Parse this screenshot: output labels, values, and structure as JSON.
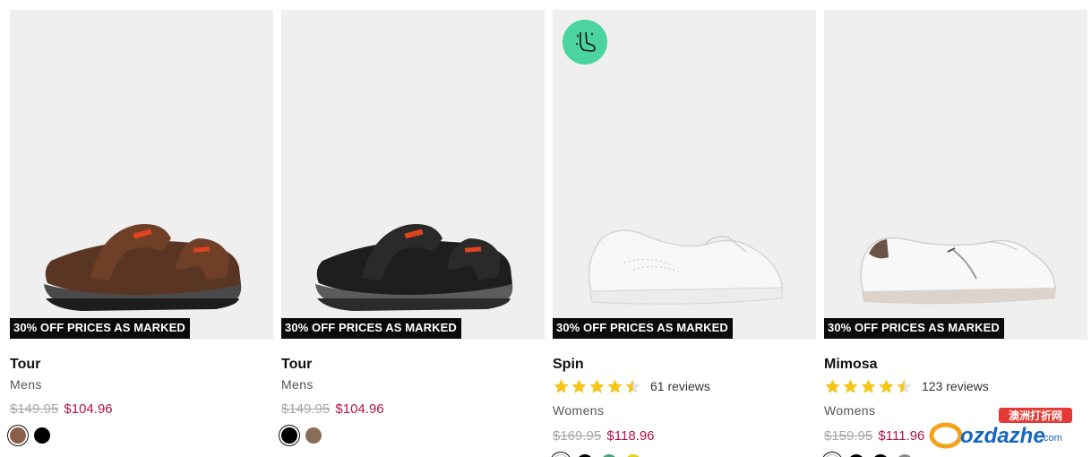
{
  "products": [
    {
      "name": "Tour",
      "category": "Mens",
      "old_price": "$149.95",
      "new_price": "$104.96",
      "promo": "30% OFF PRICES AS MARKED",
      "image_icon": "brown-leather-sandal-image",
      "colors": [
        "#8a5f45",
        "#000000"
      ],
      "selected_color": 0
    },
    {
      "name": "Tour",
      "category": "Mens",
      "old_price": "$149.95",
      "new_price": "$104.96",
      "promo": "30% OFF PRICES AS MARKED",
      "image_icon": "black-leather-sandal-image",
      "colors": [
        "#000000",
        "#8a6d56"
      ],
      "selected_color": 0
    },
    {
      "name": "Spin",
      "category": "Womens",
      "old_price": "$169.95",
      "new_price": "$118.96",
      "promo": "30% OFF PRICES AS MARKED",
      "rating": 4.5,
      "reviews": "61 reviews",
      "badge_icon": "foot-comfort-icon",
      "image_icon": "white-sneaker-image",
      "colors": [
        "#ffffff",
        "#000000",
        "#4aa37a",
        "#e5d020"
      ],
      "selected_color": 0
    },
    {
      "name": "Mimosa",
      "category": "Womens",
      "old_price": "$159.95",
      "new_price": "$111.96",
      "promo": "30% OFF PRICES AS MARKED",
      "rating": 4.5,
      "reviews": "123 reviews",
      "image_icon": "white-zip-sneaker-image",
      "colors": [
        "#ffffff",
        "#000000",
        "#000000",
        "#888888"
      ],
      "selected_color": 0
    }
  ],
  "watermark": {
    "top": "澳洲打折网",
    "main": "ozdazhe",
    "suffix": ".com"
  },
  "colors": {
    "sale_price": "#b5124a",
    "old_price": "#a7a7a7",
    "star": "#f5c518",
    "badge": "#4cd4a0"
  }
}
